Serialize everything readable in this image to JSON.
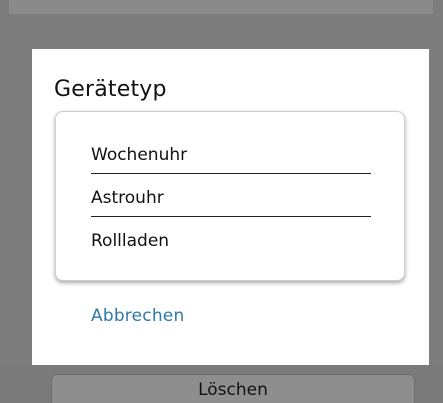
{
  "dialog": {
    "title": "Gerätetyp",
    "options": [
      {
        "label": "Wochenuhr"
      },
      {
        "label": "Astrouhr"
      },
      {
        "label": "Rollladen"
      }
    ],
    "cancel_label": "Abbrechen"
  },
  "background": {
    "delete_label": "Löschen"
  },
  "colors": {
    "overlay": "#7d7d7d",
    "dialog_bg": "#ffffff",
    "accent_link": "#2e7aa8"
  }
}
